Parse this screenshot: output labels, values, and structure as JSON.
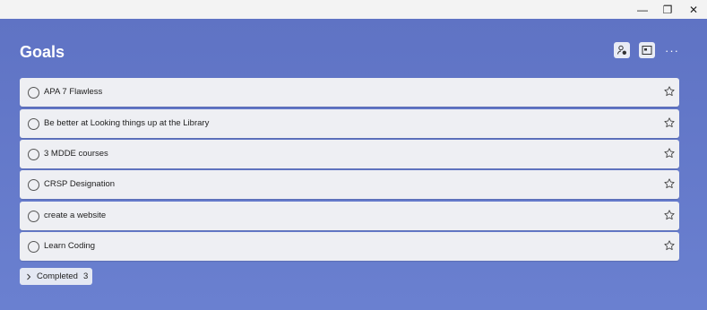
{
  "window": {
    "minimize_glyph": "—",
    "restore_glyph": "❐",
    "close_glyph": "✕"
  },
  "page": {
    "title": "Goals",
    "more_glyph": "···"
  },
  "tasks": [
    {
      "title": "APA 7 Flawless"
    },
    {
      "title": "Be better at Looking things up at the Library"
    },
    {
      "title": "3 MDDE courses"
    },
    {
      "title": "CRSP Designation"
    },
    {
      "title": "create a website"
    },
    {
      "title": "Learn Coding"
    }
  ],
  "completed": {
    "label": "Completed",
    "count": "3"
  },
  "colors": {
    "background": "#6a80d0",
    "task_background": "#eeeff3"
  },
  "icons": {
    "share": "share-list-icon",
    "view": "view-options-icon",
    "more": "more-options-icon",
    "checkbox": "circle-icon",
    "star": "star-outline-icon",
    "chevron": "chevron-right-icon"
  }
}
